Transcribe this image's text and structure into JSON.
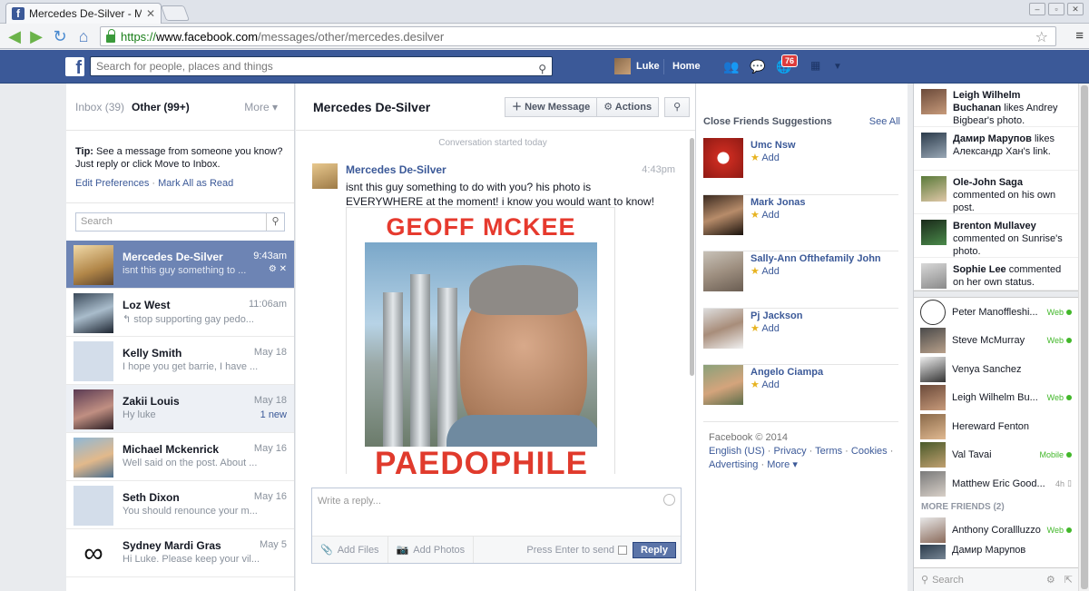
{
  "browser": {
    "tab_title": "Mercedes De-Silver - Mess",
    "url_scheme": "https://",
    "url_host": "www.facebook.com",
    "url_path": "/messages/other/mercedes.desilver"
  },
  "topbar": {
    "search_placeholder": "Search for people, places and things",
    "user_name": "Luke",
    "home_label": "Home",
    "notif_count": "76"
  },
  "left": {
    "inbox_label": "Inbox",
    "inbox_count": "(39)",
    "other_label": "Other",
    "other_count": "(99+)",
    "more_label": "More ▾",
    "tip_label": "Tip:",
    "tip_text": "See a message from someone you know? Just reply or click Move to Inbox.",
    "edit_prefs": "Edit Preferences",
    "mark_all": "Mark All as Read",
    "search_placeholder": "Search",
    "threads": [
      {
        "name": "Mercedes De-Silver",
        "snippet": "isnt this guy something to ...",
        "time": "9:43am",
        "new": ""
      },
      {
        "name": "Loz West",
        "snippet": "↰ stop supporting gay pedo...",
        "time": "11:06am",
        "new": ""
      },
      {
        "name": "Kelly Smith",
        "snippet": "I hope you get barrie, I have ...",
        "time": "May 18",
        "new": ""
      },
      {
        "name": "Zakii Louis",
        "snippet": "Hy luke",
        "time": "May 18",
        "new": "1 new"
      },
      {
        "name": "Michael Mckenrick",
        "snippet": "Well said on the post. About ...",
        "time": "May 16",
        "new": ""
      },
      {
        "name": "Seth Dixon",
        "snippet": "You should renounce your m...",
        "time": "May 16",
        "new": ""
      },
      {
        "name": "Sydney Mardi Gras",
        "snippet": "Hi Luke. Please keep your vil...",
        "time": "May 5",
        "new": ""
      }
    ]
  },
  "middle": {
    "conversation_title": "Mercedes De-Silver",
    "new_message_label": "New Message",
    "actions_label": "Actions",
    "started_label": "Conversation started today",
    "message": {
      "author": "Mercedes De-Silver",
      "time": "4:43pm",
      "text": "isnt this guy something to do with you? his photo is EVERYWHERE at the moment! i know you would want to know!",
      "photo_top_text": "GEOFF MCKEE",
      "photo_bottom_text": "PAEDOPHILE"
    },
    "composer": {
      "placeholder": "Write a reply...",
      "add_files": "Add Files",
      "add_photos": "Add Photos",
      "press_enter": "Press Enter to send",
      "reply_label": "Reply"
    }
  },
  "right": {
    "suggestions_title": "Close Friends Suggestions",
    "see_all": "See All",
    "add_label": "Add",
    "suggestions": [
      {
        "name": "Umc Nsw"
      },
      {
        "name": "Mark Jonas"
      },
      {
        "name": "Sally-Ann Ofthefamily John"
      },
      {
        "name": "Pj Jackson"
      },
      {
        "name": "Angelo Ciampa"
      }
    ],
    "footer": {
      "copyright": "Facebook © 2014",
      "links": [
        "English (US)",
        "Privacy",
        "Terms",
        "Cookies",
        "Advertising",
        "More ▾"
      ]
    }
  },
  "chat": {
    "activity": [
      {
        "name": "Leigh Wilhelm Buchanan",
        "text": "likes Andrey Bigbear's photo."
      },
      {
        "name": "Дамир Марупов",
        "text": "likes Александр Хан's link."
      },
      {
        "name": "Ole-John Saga",
        "text": "commented on his own post."
      },
      {
        "name": "Brenton Mullavey",
        "text": "commented on Sunrise's photo."
      },
      {
        "name": "Sophie Lee",
        "text": "commented on her own status."
      }
    ],
    "friends": [
      {
        "name": "Peter Manoffleshi...",
        "status": "Web"
      },
      {
        "name": "Steve McMurray",
        "status": "Web"
      },
      {
        "name": "Venya Sanchez",
        "status": ""
      },
      {
        "name": "Leigh Wilhelm Bu...",
        "status": "Web"
      },
      {
        "name": "Hereward Fenton",
        "status": ""
      },
      {
        "name": "Val Tavai",
        "status": "Mobile"
      },
      {
        "name": "Matthew Eric Good...",
        "status": "4h"
      }
    ],
    "more_friends_label": "MORE FRIENDS (2)",
    "more_friends": [
      {
        "name": "Anthony Corallluzzo",
        "status": "Web"
      },
      {
        "name": "Дамир Марупов",
        "status": ""
      }
    ],
    "search_placeholder": "Search"
  },
  "colors": {
    "fb_blue": "#3b5998",
    "selected_thread": "#6d84b4",
    "online_green": "#42b72a",
    "alert_red": "#e63a2e"
  }
}
